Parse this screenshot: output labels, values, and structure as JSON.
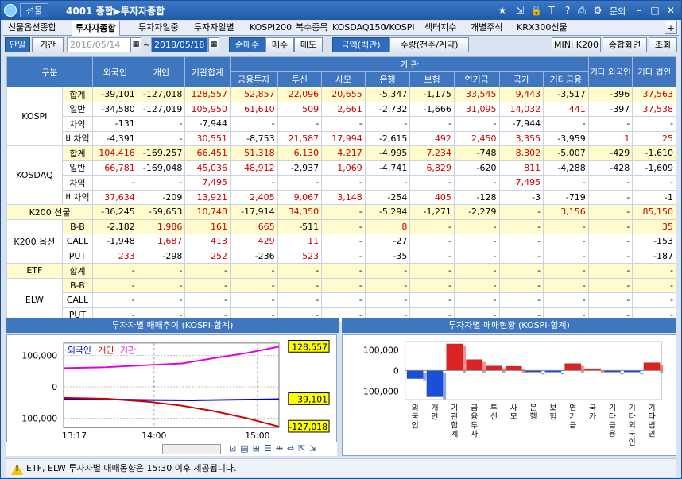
{
  "titlebar": {
    "tab_label": "선물",
    "title": "4001 종합▶투자자종합",
    "menu_label": "문의"
  },
  "tabs": [
    "선물옵션종합",
    "투자자종합",
    "투자자일중",
    "투자자일별",
    "KOSPI200",
    "복수종목",
    "KOSDAQ150",
    "VKOSPI",
    "섹터지수",
    "개별주식",
    "KRX300선물"
  ],
  "toolbar": {
    "single": "단일",
    "period": "기간",
    "date_from": "2018/05/14",
    "tilde": "~",
    "date_to": "2018/05/18",
    "net_buy": "순매수",
    "buy": "매수",
    "sell": "매도",
    "amount": "금액(백만)",
    "quantity": "수량(천주/계약)",
    "mini": "MINI K200",
    "summary": "종합화면",
    "refresh": "조회",
    "plus": "+"
  },
  "grid": {
    "headers": {
      "category": "구분",
      "foreign": "외국인",
      "individual": "개인",
      "inst_total": "기관합계",
      "institution": "기 관",
      "fin_invest": "금융투자",
      "trust": "투신",
      "private": "사모",
      "bank": "은행",
      "insurance": "보험",
      "pension": "연기금",
      "nation": "국가",
      "other_fin": "기타금융",
      "other_foreign": "기타 외국인",
      "other_corp": "기타 법인"
    },
    "groups": [
      {
        "name": "KOSPI",
        "rows": [
          {
            "sub": "합계",
            "hl": true,
            "v": [
              "-39,101",
              "-127,018",
              "128,557",
              "52,857",
              "22,096",
              "20,655",
              "-5,347",
              "-1,175",
              "33,545",
              "9,443",
              "-3,517",
              "-396",
              "37,563"
            ]
          },
          {
            "sub": "일반",
            "hl": false,
            "v": [
              "-34,580",
              "-127,019",
              "105,950",
              "61,610",
              "509",
              "2,661",
              "-2,732",
              "-1,666",
              "31,095",
              "14,032",
              "441",
              "-397",
              "37,538"
            ]
          },
          {
            "sub": "차익",
            "hl": false,
            "v": [
              "-131",
              "-",
              "-7,944",
              "-",
              "-",
              "-",
              "-",
              "-",
              "-",
              "-7,944",
              "-",
              "-",
              "-"
            ]
          },
          {
            "sub": "비차익",
            "hl": false,
            "v": [
              "-4,391",
              "-",
              "30,551",
              "-8,753",
              "21,587",
              "17,994",
              "-2,615",
              "492",
              "2,450",
              "3,355",
              "-3,959",
              "1",
              "25"
            ]
          }
        ]
      },
      {
        "name": "KOSDAQ",
        "rows": [
          {
            "sub": "합계",
            "hl": true,
            "v": [
              "104,416",
              "-169,257",
              "66,451",
              "51,318",
              "6,130",
              "4,217",
              "-4,995",
              "7,234",
              "-748",
              "8,302",
              "-5,007",
              "-429",
              "-1,610"
            ]
          },
          {
            "sub": "일반",
            "hl": false,
            "v": [
              "66,781",
              "-169,048",
              "45,036",
              "48,912",
              "-2,937",
              "1,069",
              "-4,741",
              "6,829",
              "-620",
              "811",
              "-4,288",
              "-428",
              "-1,609"
            ]
          },
          {
            "sub": "차익",
            "hl": false,
            "v": [
              "-",
              "-",
              "7,495",
              "-",
              "-",
              "-",
              "-",
              "-",
              "-",
              "7,495",
              "-",
              "-",
              "-"
            ]
          },
          {
            "sub": "비차익",
            "hl": false,
            "v": [
              "37,634",
              "-209",
              "13,921",
              "2,405",
              "9,067",
              "3,148",
              "-254",
              "405",
              "-128",
              "-3",
              "-719",
              "-",
              "-1"
            ]
          }
        ]
      },
      {
        "name": "K200 선물",
        "rows": [
          {
            "sub": "",
            "hl": true,
            "v": [
              "-36,245",
              "-59,653",
              "10,748",
              "-17,914",
              "34,350",
              "-",
              "-5,294",
              "-1,271",
              "-2,279",
              "-",
              "3,156",
              "-",
              "85,150"
            ]
          }
        ]
      },
      {
        "name": "K200 옵션",
        "rows": [
          {
            "sub": "B-B",
            "hl": true,
            "v": [
              "-2,182",
              "1,986",
              "161",
              "665",
              "-511",
              "-",
              "8",
              "-",
              "-",
              "-",
              "-",
              "-",
              "35"
            ]
          },
          {
            "sub": "CALL",
            "hl": false,
            "v": [
              "-1,948",
              "1,687",
              "413",
              "429",
              "11",
              "-",
              "-27",
              "-",
              "-",
              "-",
              "-",
              "-",
              "-153"
            ]
          },
          {
            "sub": "PUT",
            "hl": false,
            "v": [
              "233",
              "-298",
              "252",
              "-236",
              "523",
              "-",
              "-35",
              "-",
              "-",
              "-",
              "-",
              "-",
              "-187"
            ]
          }
        ]
      },
      {
        "name": "ETF",
        "rows": [
          {
            "sub": "합계",
            "hl": true,
            "v": [
              "-",
              "-",
              "-",
              "-",
              "-",
              "-",
              "-",
              "-",
              "-",
              "-",
              "-",
              "-",
              "-"
            ]
          }
        ]
      },
      {
        "name": "ELW",
        "rows": [
          {
            "sub": "B-B",
            "hl": true,
            "v": [
              "-",
              "-",
              "-",
              "-",
              "-",
              "-",
              "-",
              "-",
              "-",
              "-",
              "-",
              "-",
              "-"
            ]
          },
          {
            "sub": "CALL",
            "hl": false,
            "v": [
              "-",
              "-",
              "-",
              "-",
              "-",
              "-",
              "-",
              "-",
              "-",
              "-",
              "-",
              "-",
              "-"
            ]
          },
          {
            "sub": "PUT",
            "hl": false,
            "v": [
              "-",
              "-",
              "-",
              "-",
              "-",
              "-",
              "-",
              "-",
              "-",
              "-",
              "-",
              "-",
              "-"
            ]
          }
        ]
      }
    ]
  },
  "panels": {
    "left_title": "투자자별 매매추이 (KOSPI-합계)",
    "right_title": "투자자별 매매현황 (KOSPI-합계)"
  },
  "chart_data": [
    {
      "type": "line",
      "title": "투자자별 매매추이 (KOSPI-합계)",
      "legend": [
        "외국인",
        "개인",
        "기관"
      ],
      "x_ticks": [
        "13:17",
        "14:00",
        "15:00"
      ],
      "y_ticks": [
        "100,000",
        "0",
        "-100,000"
      ],
      "ylim": [
        -130000,
        140000
      ],
      "series": [
        {
          "name": "외국인",
          "color": "#0000cc",
          "points": [
            [
              0,
              -38000
            ],
            [
              0.2,
              -40000
            ],
            [
              0.4,
              -42000
            ],
            [
              0.6,
              -43000
            ],
            [
              0.8,
              -41000
            ],
            [
              0.95,
              -40000
            ],
            [
              1,
              -39101
            ]
          ],
          "end_label": "-39,101"
        },
        {
          "name": "개인",
          "color": "#cc0000",
          "points": [
            [
              0,
              -35000
            ],
            [
              0.2,
              -38000
            ],
            [
              0.4,
              -48000
            ],
            [
              0.55,
              -60000
            ],
            [
              0.7,
              -78000
            ],
            [
              0.85,
              -100000
            ],
            [
              1,
              -127018
            ]
          ],
          "end_label": "-127,018"
        },
        {
          "name": "기관",
          "color": "#e000e0",
          "points": [
            [
              0,
              60000
            ],
            [
              0.2,
              63000
            ],
            [
              0.4,
              70000
            ],
            [
              0.55,
              75000
            ],
            [
              0.7,
              92000
            ],
            [
              0.85,
              108000
            ],
            [
              1,
              128557
            ]
          ],
          "end_label": "128,557"
        }
      ]
    },
    {
      "type": "bar",
      "title": "투자자별 매매현황 (KOSPI-합계)",
      "categories": [
        "외국인",
        "개인",
        "기관합계",
        "금융투자",
        "투신",
        "사모",
        "은행",
        "보험",
        "연기금",
        "국가",
        "기타금융",
        "기타외국인",
        "기타법인"
      ],
      "values": [
        -39101,
        -127018,
        128557,
        52857,
        22096,
        20655,
        -5347,
        -1175,
        33545,
        9443,
        -3517,
        -396,
        37563
      ],
      "y_ticks": [
        "100,000",
        "0",
        "-100,000"
      ],
      "ylim": [
        -140000,
        140000
      ],
      "colors": {
        "pos": "#dd2222",
        "neg": "#1a4fd8"
      }
    }
  ],
  "notice": "ETF, ELW 투자자별 매매동향은 15:30 이후 제공됩니다."
}
